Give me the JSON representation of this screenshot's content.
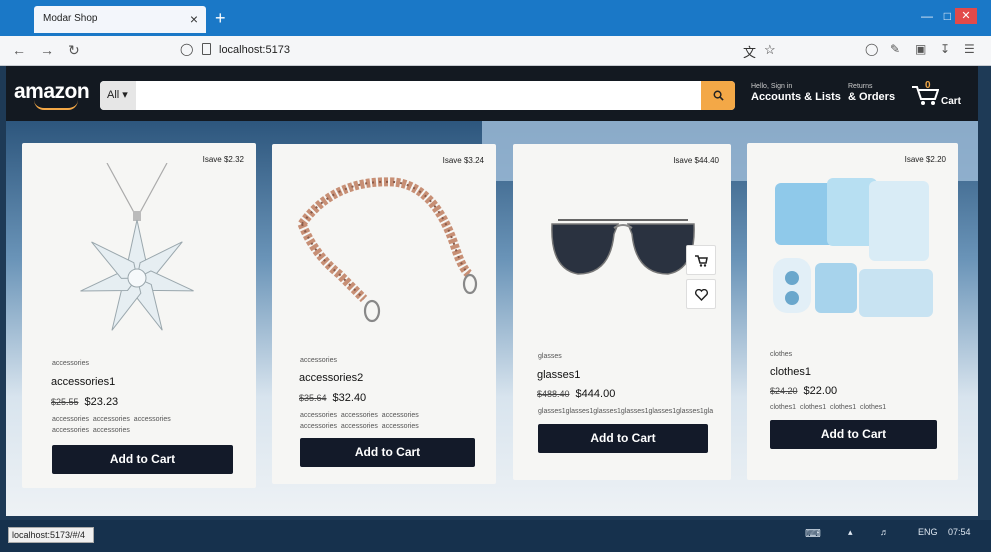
{
  "browser": {
    "tab_title": "Modar Shop",
    "tab_close": "×",
    "new_tab": "+",
    "url": "localhost:5173",
    "status_url": "localhost:5173/#/4"
  },
  "header": {
    "logo": "amazon",
    "search": {
      "category": "All ▾",
      "placeholder": ""
    },
    "accounts_small": "Hello, Sign in",
    "accounts_big": "Accounts & Lists",
    "orders_small": "Returns",
    "orders_big": "& Orders",
    "cart_count": "0",
    "cart_label": "Cart"
  },
  "products": [
    {
      "save": "Isave $2.32",
      "category": "accessories",
      "name": "accessories1",
      "old_price": "$25.55",
      "price": "$23.23",
      "tags_line1": "accessories     accessories     accessories",
      "tags_line2": "accessories accessories",
      "button": "Add to Cart",
      "image_icon": "snowflake-crystal-pendant"
    },
    {
      "save": "Isave $3.24",
      "category": "accessories",
      "name": "accessories2",
      "old_price": "$35.64",
      "price": "$32.40",
      "tags_line1": "accessories     accessories     accessories",
      "tags_line2": "accessories accessories accessories",
      "button": "Add to Cart",
      "image_icon": "chain-strap"
    },
    {
      "save": "Isave $44.40",
      "category": "glasses",
      "name": "glasses1",
      "old_price": "$488.40",
      "price": "$444.00",
      "tags_line1": "glasses1glasses1glasses1glasses1glasses1glasses1gla",
      "tags_line2": "",
      "button": "Add to Cart",
      "image_icon": "sunglasses"
    },
    {
      "save": "Isave $2.20",
      "category": "clothes",
      "name": "clothes1",
      "old_price": "$24.20",
      "price": "$22.00",
      "tags_line1": "clothes1 clothes1 clothes1 clothes1",
      "tags_line2": "",
      "button": "Add to Cart",
      "image_icon": "baby-clothes-set"
    }
  ],
  "taskbar": {
    "lang": "ENG",
    "time": "07:54"
  },
  "colors": {
    "header_bg": "#131921",
    "search_button": "#f3a847",
    "add_to_cart": "#131a29",
    "tabbar": "#1a78c7"
  }
}
